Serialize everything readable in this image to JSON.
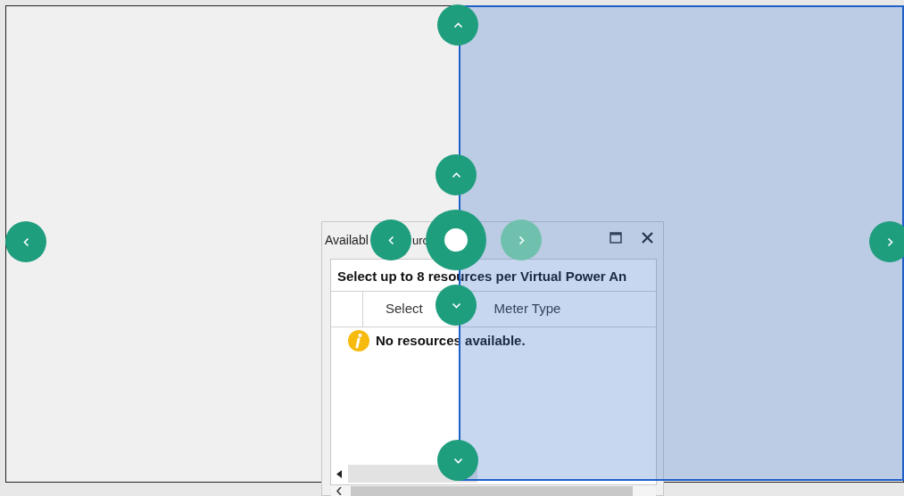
{
  "floating_panel": {
    "title_fragments": [
      "Availabl",
      "urc"
    ],
    "grid": {
      "caption": "Select up to 8 resources per Virtual Power An",
      "columns": [
        "Select",
        "Meter Type"
      ],
      "empty_message": "No resources available."
    }
  },
  "edge_guides": [
    {
      "kind": "up"
    },
    {
      "kind": "left"
    },
    {
      "kind": "right"
    },
    {
      "kind": "down"
    }
  ],
  "center_guides": [
    {
      "kind": "up",
      "selected": false
    },
    {
      "kind": "left",
      "selected": false
    },
    {
      "kind": "fill",
      "selected": false
    },
    {
      "kind": "right",
      "selected": true
    },
    {
      "kind": "down",
      "selected": false
    }
  ]
}
